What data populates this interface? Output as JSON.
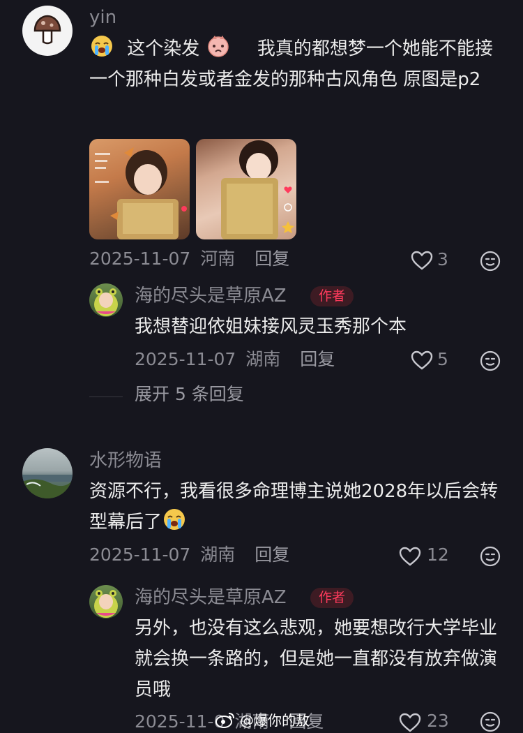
{
  "comments": [
    {
      "username": "yin",
      "text_before_emoji": "这个染发",
      "text_after_emoji": "我真的都想梦一个她能不能接一个那种白发或者金发的那种古风角色 原图是p2",
      "date": "2025-11-07",
      "location": "河南",
      "reply_label": "回复",
      "likes": "3",
      "reply": {
        "username": "海的尽头是草原AZ",
        "badge": "作者",
        "text": "我想替迎依姐妹接风灵玉秀那个本",
        "date": "2025-11-07",
        "location": "湖南",
        "reply_label": "回复",
        "likes": "5"
      },
      "expand_label": "展开 5 条回复"
    },
    {
      "username": "水形物语",
      "text": "资源不行，我看很多命理博主说她2028年以后会转型幕后了",
      "date": "2025-11-07",
      "location": "湖南",
      "reply_label": "回复",
      "likes": "12",
      "reply": {
        "username": "海的尽头是草原AZ",
        "badge": "作者",
        "text": "另外，也没有这么悲观，她要想改行大学毕业就会换一条路的，但是她一直都没有放弃做演员哦",
        "date": "2025-11-0",
        "location": "湖南",
        "reply_label": "回复",
        "likes": "23"
      }
    }
  ],
  "watermark": "@爆你的敖",
  "colors": {
    "background": "#16161e",
    "badge_text": "#ff3b5c",
    "badge_bg": "#3d1b23",
    "muted": "#8b8b93"
  },
  "icons": [
    "mushroom-avatar-icon",
    "crying-emoji-icon",
    "pouting-emoji-icon",
    "heart-outline-icon",
    "smiley-react-icon",
    "weibo-logo-icon"
  ]
}
